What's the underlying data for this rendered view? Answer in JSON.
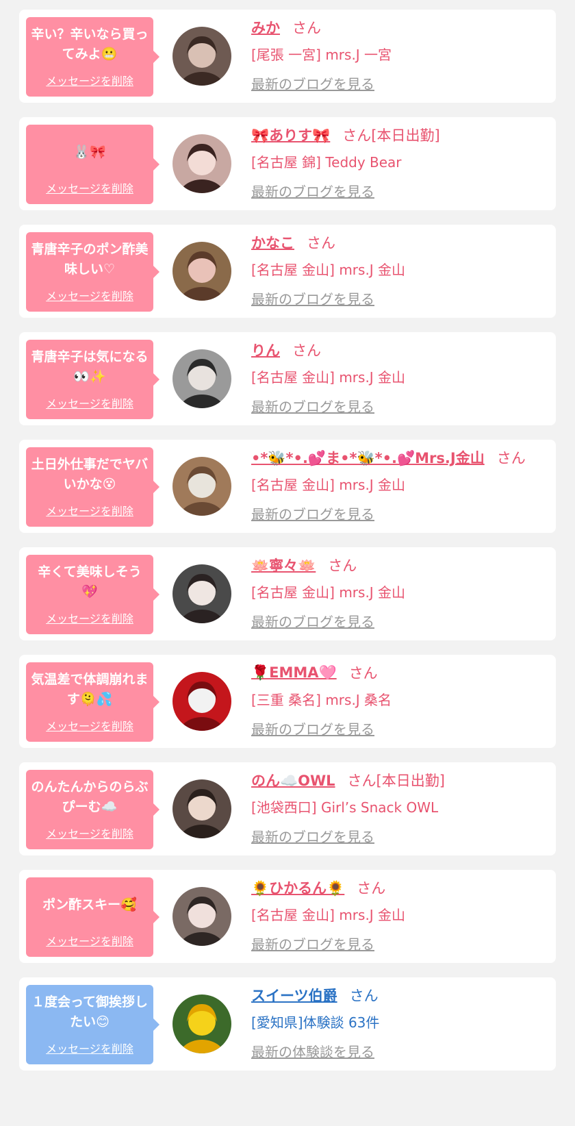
{
  "cards": [
    {
      "message": "辛い？辛いなら買ってみよ😬",
      "delete_label": "メッセージを削除",
      "name": "みか",
      "suffix": "さん",
      "shop": "[尾張 一宮] mrs.J 一宮",
      "blog_link": "最新のブログを見る",
      "bubble_color": "pink",
      "avatar_colors": [
        "#6e5a52",
        "#d9c0b4",
        "#3b2a24"
      ]
    },
    {
      "message": "🐰🎀",
      "delete_label": "メッセージを削除",
      "name": "🎀ありす🎀",
      "suffix": "さん[本日出勤]",
      "shop": "[名古屋 錦] Teddy Bear",
      "blog_link": "最新のブログを見る",
      "bubble_color": "pink",
      "avatar_colors": [
        "#c8a8a2",
        "#f3dcd6",
        "#3a2320"
      ]
    },
    {
      "message": "青唐辛子のポン酢美味しい♡",
      "delete_label": "メッセージを削除",
      "name": "かなこ",
      "suffix": "さん",
      "shop": "[名古屋 金山] mrs.J 金山",
      "blog_link": "最新のブログを見る",
      "bubble_color": "pink",
      "avatar_colors": [
        "#8a6a4a",
        "#e9c2b8",
        "#5b3b2a"
      ]
    },
    {
      "message": "青唐辛子は気になる👀✨",
      "delete_label": "メッセージを削除",
      "name": "りん",
      "suffix": "さん",
      "shop": "[名古屋 金山] mrs.J 金山",
      "blog_link": "最新のブログを見る",
      "bubble_color": "pink",
      "avatar_colors": [
        "#9a9a9a",
        "#e8e2de",
        "#2a2a2a"
      ]
    },
    {
      "message": "土日外仕事だでヤバいかな😵",
      "delete_label": "メッセージを削除",
      "name": "•*🐝*•.💕ま•*🐝*•.💕Mrs.J金山",
      "suffix": "さん",
      "shop": "[名古屋 金山] mrs.J 金山",
      "blog_link": "最新のブログを見る",
      "bubble_color": "pink",
      "avatar_colors": [
        "#a07a5a",
        "#e8e4dc",
        "#6a4a34"
      ]
    },
    {
      "message": "辛くて美味しそう💖",
      "delete_label": "メッセージを削除",
      "name": "🪷寧々🪷",
      "suffix": "さん",
      "shop": "[名古屋 金山] mrs.J 金山",
      "blog_link": "最新のブログを見る",
      "bubble_color": "pink",
      "avatar_colors": [
        "#4a4a4a",
        "#efe6e2",
        "#2a2222"
      ]
    },
    {
      "message": "気温差で体調崩れます🫠💦",
      "delete_label": "メッセージを削除",
      "name": "🌹EMMA🩷",
      "suffix": "さん",
      "shop": "[三重 桑名] mrs.J 桑名",
      "blog_link": "最新のブログを見る",
      "bubble_color": "pink",
      "avatar_colors": [
        "#c4161c",
        "#f2f2f2",
        "#7a0c10"
      ]
    },
    {
      "message": "のんたんからのらぶぴーむ☁️",
      "delete_label": "メッセージを削除",
      "name": "のん☁️OWL",
      "suffix": "さん[本日出勤]",
      "shop": "[池袋西口] Girl’s Snack OWL",
      "blog_link": "最新のブログを見る",
      "bubble_color": "pink",
      "avatar_colors": [
        "#5a4a44",
        "#ecd8cc",
        "#2a201c"
      ]
    },
    {
      "message": "ポン酢スキー🥰",
      "delete_label": "メッセージを削除",
      "name": "🌻ひかるん🌻",
      "suffix": "さん",
      "shop": "[名古屋 金山] mrs.J 金山",
      "blog_link": "最新のブログを見る",
      "bubble_color": "pink",
      "avatar_colors": [
        "#7a6a64",
        "#f0e0dc",
        "#2e2624"
      ]
    },
    {
      "message": "１度会って御挨拶したい😊",
      "delete_label": "メッセージを削除",
      "name": "スイーツ伯爵",
      "suffix": "さん",
      "shop": "[愛知県]体験談 63件",
      "blog_link": "最新の体験談を見る",
      "bubble_color": "blue",
      "avatar_colors": [
        "#3c6a2a",
        "#f5d21a",
        "#e2a400"
      ]
    }
  ]
}
